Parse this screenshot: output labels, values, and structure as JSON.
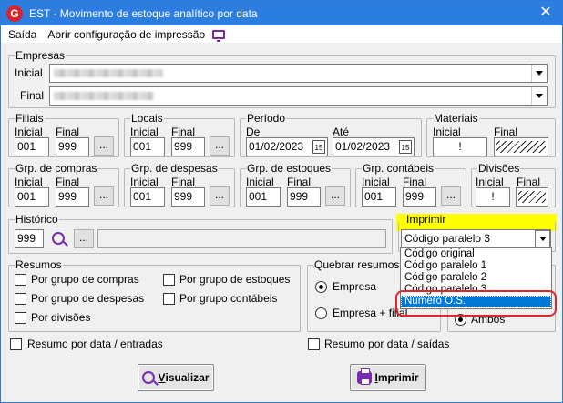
{
  "window": {
    "title": "EST - Movimento de estoque  analítico por data",
    "close_glyph": "✕",
    "app_letter": "G"
  },
  "menu": {
    "saida": "Saída",
    "config": "Abrir configuração de impressão"
  },
  "empresas": {
    "title": "Empresas",
    "inicial": "Inicial",
    "final": "Final"
  },
  "filiais": {
    "title": "Filiais",
    "inicial_label": "Inicial",
    "final_label": "Final",
    "inicial": "001",
    "final": "999",
    "btn": "..."
  },
  "locais": {
    "title": "Locais",
    "inicial_label": "Inicial",
    "final_label": "Final",
    "inicial": "001",
    "final": "999",
    "btn": "..."
  },
  "periodo": {
    "title": "Período",
    "de_label": "De",
    "ate_label": "Até",
    "de": "01/02/2023",
    "ate": "01/02/2023",
    "cal_icon": "15"
  },
  "materiais": {
    "title": "Materiais",
    "inicial_label": "Inicial",
    "final_label": "Final",
    "inicial": "!"
  },
  "grp_compras": {
    "title": "Grp. de compras",
    "inicial_label": "Inicial",
    "final_label": "Final",
    "inicial": "001",
    "final": "999",
    "btn": "..."
  },
  "grp_despesas": {
    "title": "Grp. de despesas",
    "inicial_label": "Inicial",
    "final_label": "Final",
    "inicial": "001",
    "final": "999",
    "btn": "..."
  },
  "grp_estoques": {
    "title": "Grp. de estoques",
    "inicial_label": "Inicial",
    "final_label": "Final",
    "inicial": "001",
    "final": "999",
    "btn": "..."
  },
  "grp_contabeis": {
    "title": "Grp. contábeis",
    "inicial_label": "Inicial",
    "final_label": "Final",
    "inicial": "001",
    "final": "999",
    "btn": "..."
  },
  "divisoes": {
    "title": "Divisões",
    "inicial_label": "Inicial",
    "final_label": "Final",
    "inicial": "!"
  },
  "historico": {
    "title": "Histórico",
    "value": "999",
    "btn": "..."
  },
  "imprimir_group": {
    "title": "Imprimir",
    "selected": "Código paralelo 3",
    "options": [
      "Código original",
      "Código paralelo 1",
      "Código paralelo 2",
      "Código paralelo 3",
      "Número O.S."
    ],
    "highlight_color": "#ffff00",
    "ring_color": "#e0262b"
  },
  "resumos": {
    "title": "Resumos",
    "por_grupo_compras": "Por grupo de compras",
    "por_grupo_despesas": "Por grupo de despesas",
    "por_divisoes": "Por divisões",
    "por_grupo_estoques": "Por grupo de estoques",
    "por_grupo_contabeis": "Por grupo contábeis"
  },
  "quebrar": {
    "title": "Quebrar resumos po",
    "empresa": "Empresa",
    "empresa_filial": "Empresa + filial",
    "ambos": "Ambos"
  },
  "resumo_entradas": "Resumo por data / entradas",
  "resumo_saidas": "Resumo por data / saídas",
  "buttons": {
    "visualizar_first": "V",
    "visualizar_rest": "isualizar",
    "imprimir_first": "I",
    "imprimir_rest": "mprimir"
  },
  "accent": "#7a2ab0"
}
